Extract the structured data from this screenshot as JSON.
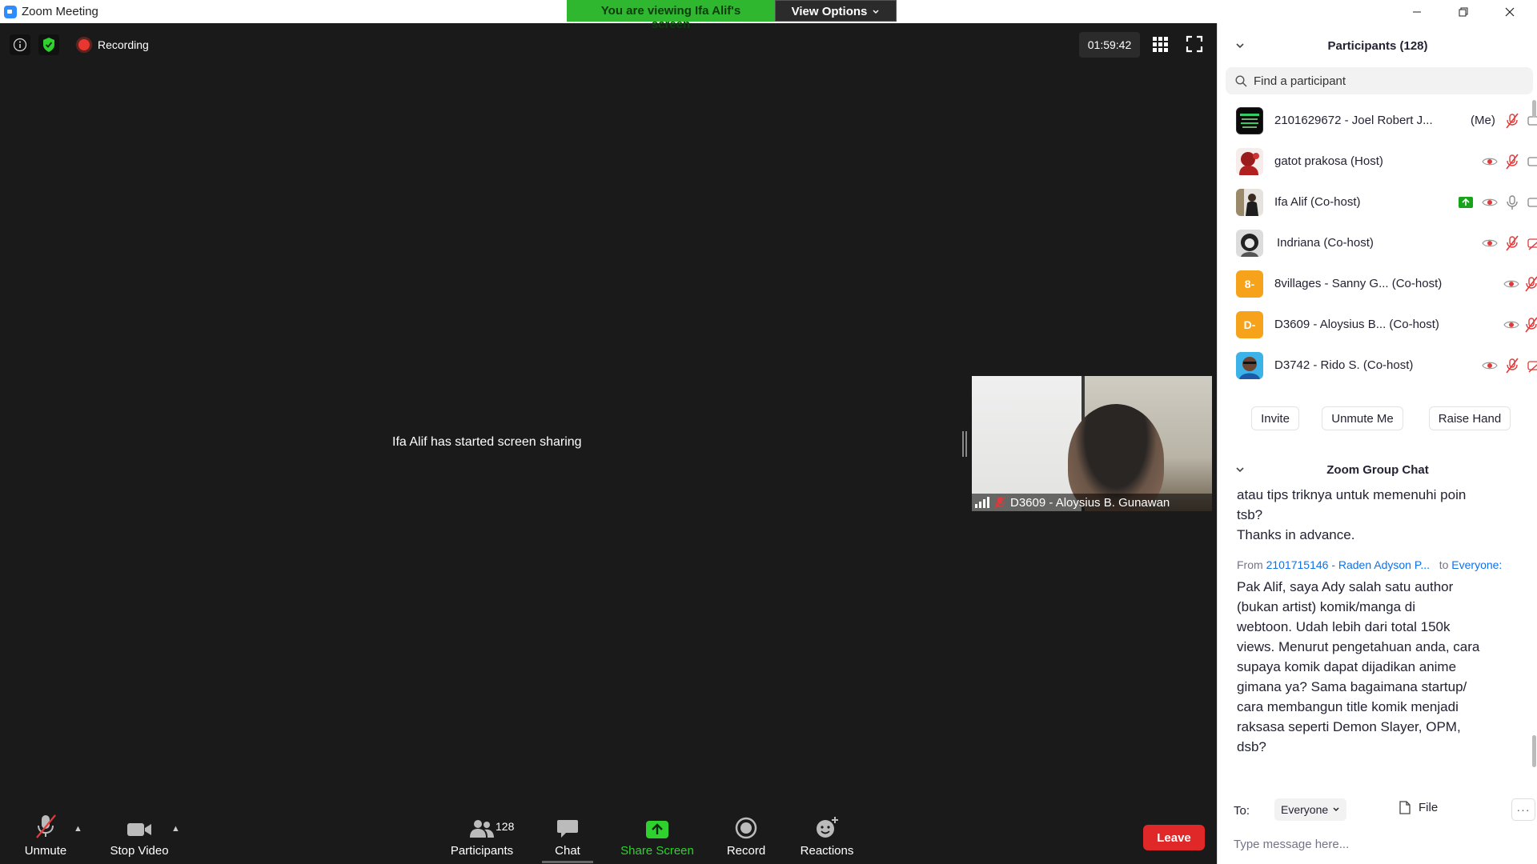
{
  "window": {
    "title": "Zoom Meeting",
    "controls": [
      "minimize-icon",
      "restore-icon",
      "close-icon"
    ]
  },
  "banner": {
    "viewing_text": "You are viewing Ifa Alif's screen",
    "view_options_label": "View Options",
    "viewing_color": "#2fb72f"
  },
  "stage": {
    "recording_label": "Recording",
    "timer": "01:59:42",
    "share_message": "Ifa Alif has started screen sharing",
    "video_tile_name": "D3609 - Aloysius B. Gunawan"
  },
  "toolbar": {
    "unmute_label": "Unmute",
    "stop_video_label": "Stop Video",
    "participants_label": "Participants",
    "participants_count": "128",
    "chat_label": "Chat",
    "share_screen_label": "Share Screen",
    "record_label": "Record",
    "reactions_label": "Reactions",
    "leave_label": "Leave",
    "leave_color": "#e02828",
    "share_color": "#2fd12f"
  },
  "participants": {
    "title": "Participants (128)",
    "search_placeholder": "Find a participant",
    "list": [
      {
        "name": "2101629672 - Joel Robert J...",
        "extra": "(Me)",
        "avatar_text": ""
      },
      {
        "name": "gatot prakosa (Host)",
        "extra": "",
        "avatar_text": ""
      },
      {
        "name": "Ifa Alif (Co-host)",
        "extra": "",
        "avatar_text": ""
      },
      {
        "name": "Indriana (Co-host)",
        "extra": "",
        "avatar_text": ""
      },
      {
        "name": "8villages - Sanny G... (Co-host)",
        "extra": "",
        "avatar_text": "8-"
      },
      {
        "name": "D3609 - Aloysius B... (Co-host)",
        "extra": "",
        "avatar_text": "D-"
      },
      {
        "name": "D3742 - Rido S. (Co-host)",
        "extra": "",
        "avatar_text": ""
      }
    ],
    "actions": {
      "invite": "Invite",
      "unmute_me": "Unmute Me",
      "raise_hand": "Raise Hand"
    }
  },
  "chat": {
    "title": "Zoom Group Chat",
    "messages": [
      {
        "text_lines": [
          "atau tips triknya untuk memenuhi poin",
          "tsb?",
          "Thanks in advance."
        ]
      },
      {
        "from_label": "From",
        "sender": "2101715146 - Raden Adyson P...",
        "to_label": "to",
        "recipient": "Everyone:",
        "text_lines": [
          "Pak Alif, saya Ady salah satu author",
          "(bukan artist) komik/manga di",
          "webtoon. Udah lebih dari total 150k",
          "views. Menurut pengetahuan anda, cara",
          "supaya komik dapat dijadikan anime",
          "gimana ya? Sama bagaimana startup/",
          "cara membangun title komik menjadi",
          "raksasa seperti Demon Slayer, OPM,",
          "dsb?"
        ]
      }
    ],
    "to_label": "To:",
    "to_value": "Everyone",
    "file_label": "File",
    "more_label": "···",
    "input_placeholder": "Type message here..."
  }
}
